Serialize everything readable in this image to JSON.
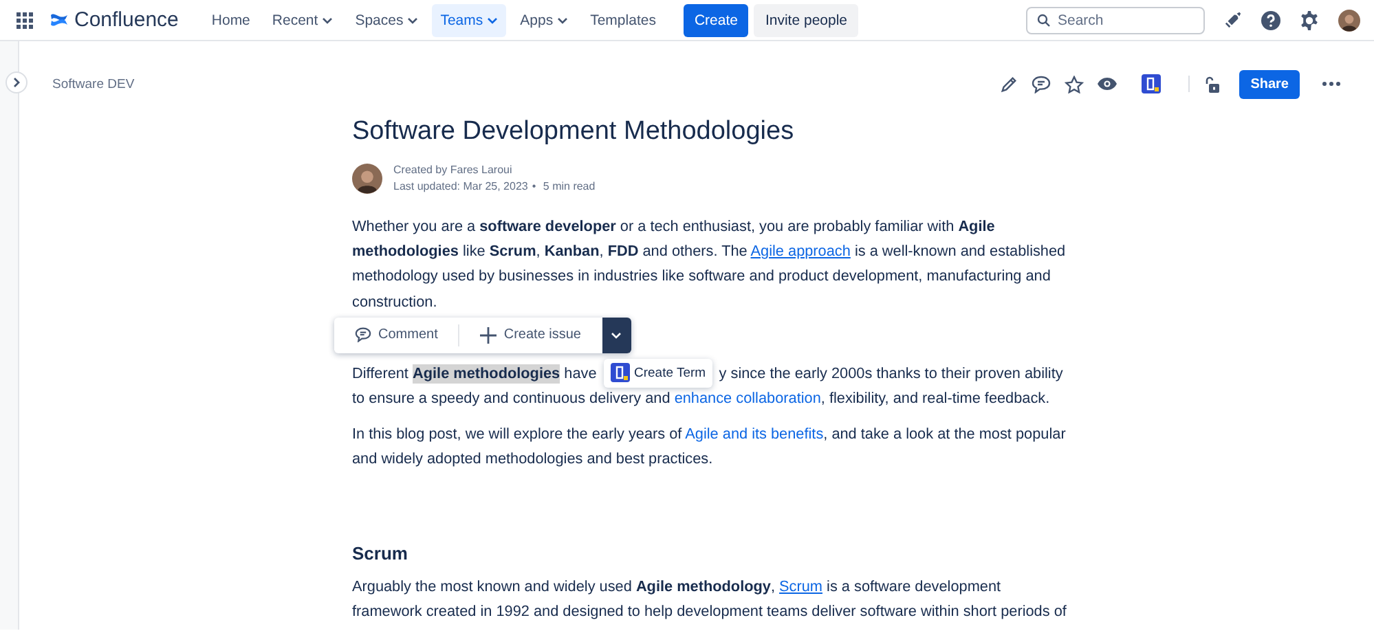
{
  "topbar": {
    "product": "Confluence",
    "nav": [
      {
        "label": "Home",
        "dropdown": false,
        "selected": false
      },
      {
        "label": "Recent",
        "dropdown": true,
        "selected": false
      },
      {
        "label": "Spaces",
        "dropdown": true,
        "selected": false
      },
      {
        "label": "Teams",
        "dropdown": true,
        "selected": true
      },
      {
        "label": "Apps",
        "dropdown": true,
        "selected": false
      },
      {
        "label": "Templates",
        "dropdown": false,
        "selected": false
      }
    ],
    "create_button": "Create",
    "invite_button": "Invite people",
    "search": {
      "placeholder": "Search"
    }
  },
  "breadcrumb": "Software DEV",
  "share_button": "Share",
  "page": {
    "title": "Software Development Methodologies",
    "byline": {
      "created": "Created by Fares Laroui",
      "updated": "Last updated: Mar 25, 2023",
      "separator": "•",
      "read_time": "5 min read"
    },
    "blocks": [
      {
        "kind": "paragraph",
        "segments": [
          {
            "kind": "text",
            "text": "Whether you are a "
          },
          {
            "kind": "bold",
            "text": "software developer"
          },
          {
            "kind": "text",
            "text": " or a tech enthusiast, you are probably familiar with "
          },
          {
            "kind": "bold",
            "text": "Agile methodologies"
          },
          {
            "kind": "text",
            "text": " like "
          },
          {
            "kind": "bold",
            "text": "Scrum"
          },
          {
            "kind": "text",
            "text": ", "
          },
          {
            "kind": "bold",
            "text": "Kanban"
          },
          {
            "kind": "text",
            "text": ", "
          },
          {
            "kind": "bold",
            "text": "FDD"
          },
          {
            "kind": "text",
            "text": " and others. The "
          },
          {
            "kind": "ulink",
            "text": "Agile approach"
          },
          {
            "kind": "text",
            "text": " is a well-known and established methodology used by businesses in industries like software and product development, manufacturing and construction."
          }
        ]
      },
      {
        "kind": "paragraph",
        "segments": [
          {
            "kind": "text",
            "text": "Different "
          },
          {
            "kind": "mark",
            "text": "Agile methodologies"
          },
          {
            "kind": "text",
            "text": " have "
          },
          {
            "kind": "covered"
          },
          {
            "kind": "text",
            "text": "y since the early 2000s thanks to their proven ability to ensure a speedy and continuous delivery and "
          },
          {
            "kind": "link",
            "text": "enhance collaboration"
          },
          {
            "kind": "text",
            "text": ", flexibility, and real-time feedback."
          }
        ]
      },
      {
        "kind": "paragraph",
        "segments": [
          {
            "kind": "text",
            "text": "In this blog post, we will explore the early years of "
          },
          {
            "kind": "link",
            "text": "Agile and its benefits"
          },
          {
            "kind": "text",
            "text": ", and take a look at the most popular and widely adopted methodologies and best practices."
          }
        ]
      },
      {
        "kind": "heading",
        "text": "Scrum"
      },
      {
        "kind": "paragraph",
        "segments": [
          {
            "kind": "text",
            "text": "Arguably the most known and widely used "
          },
          {
            "kind": "bold",
            "text": "Agile methodology"
          },
          {
            "kind": "text",
            "text": ", "
          },
          {
            "kind": "ulink",
            "text": "Scrum"
          },
          {
            "kind": "text",
            "text": " is a software development framework created in 1992 and designed to help development teams deliver software within short periods of"
          }
        ]
      }
    ]
  },
  "selection_toolbar": {
    "comment_button": "Comment",
    "create_issue_button": "Create issue"
  },
  "popup": {
    "create_term": "Create Term"
  }
}
